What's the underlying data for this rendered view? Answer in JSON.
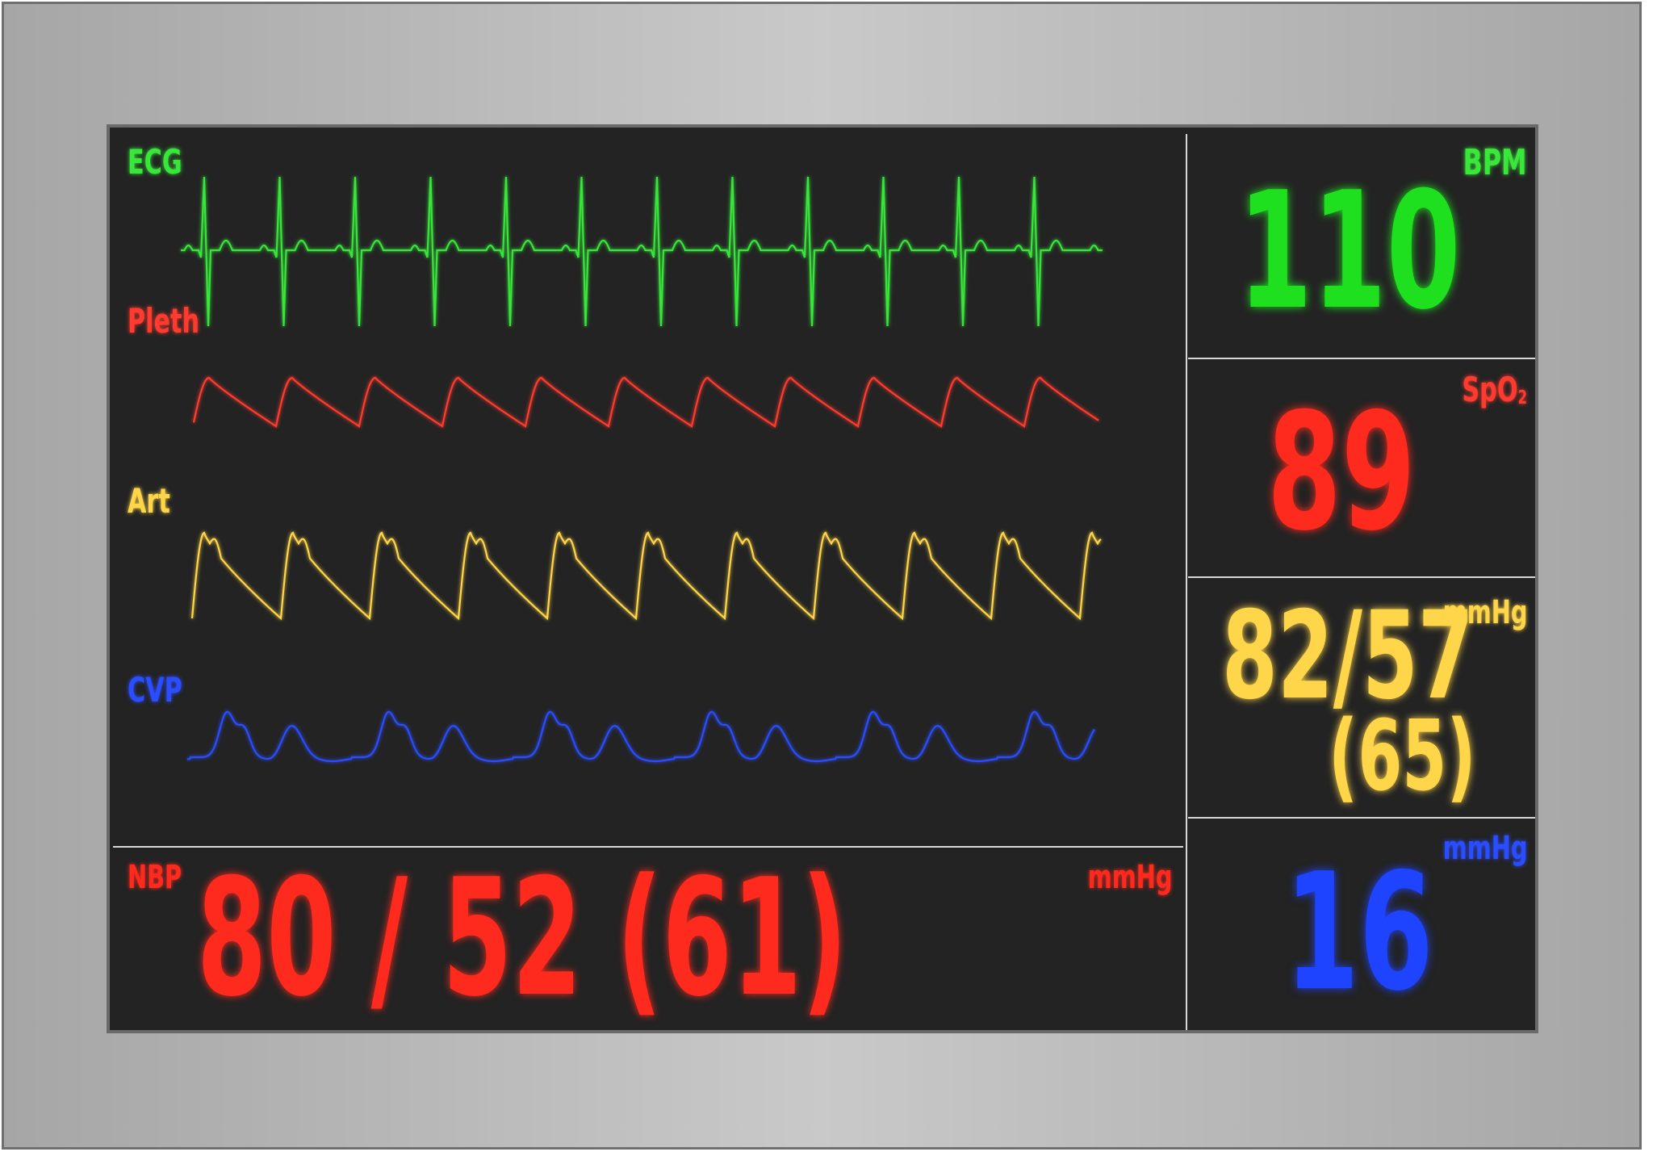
{
  "colors": {
    "ecg": "#39e63a",
    "pleth": "#ff3b2f",
    "art": "#ffd54a",
    "cvp": "#2a4dff",
    "nbp": "#ff2a1e",
    "divider": "#d8d8d8",
    "screen_bg": "#232323"
  },
  "waveforms": {
    "ecg": {
      "label": "ECG"
    },
    "pleth": {
      "label": "Pleth"
    },
    "art": {
      "label": "Art"
    },
    "cvp": {
      "label": "CVP"
    }
  },
  "nbp": {
    "label": "NBP",
    "value": "80 / 52 (61)",
    "unit": "mmHg"
  },
  "vitals": {
    "hr": {
      "label": "BPM",
      "value": "110"
    },
    "spo2": {
      "label": "SpO",
      "label_sub": "2",
      "value": "89"
    },
    "art": {
      "value": "82/57",
      "mean": "(65)",
      "unit": "mmHg"
    },
    "cvp": {
      "value": "16",
      "unit": "mmHg"
    }
  }
}
